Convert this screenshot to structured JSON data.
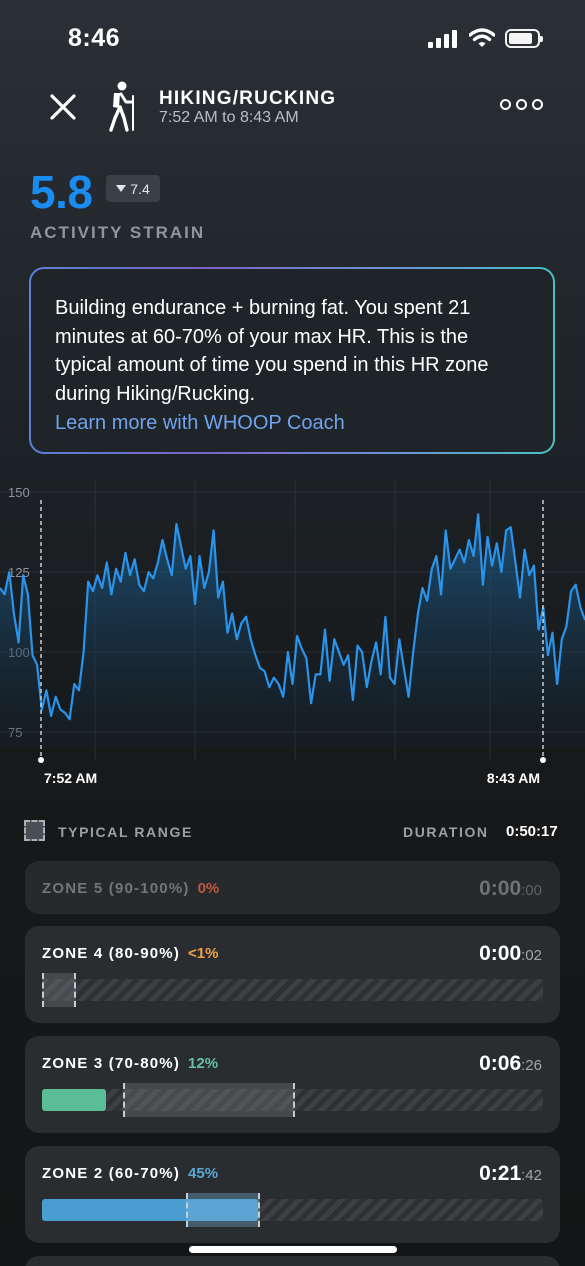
{
  "status_bar": {
    "time": "8:46"
  },
  "header": {
    "title": "HIKING/RUCKING",
    "time_range": "7:52 AM to 8:43 AM"
  },
  "strain": {
    "value": "5.8",
    "delta": "7.4",
    "label": "ACTIVITY STRAIN"
  },
  "coach": {
    "text": "Building endurance + burning fat. You spent 21 minutes at 60-70% of your max HR. This is the typical amount of time you spend in this HR zone during Hiking/Rucking.",
    "link": "Learn more with WHOOP Coach"
  },
  "chart_data": {
    "type": "line",
    "y_ticks": [
      "150",
      "125",
      "100",
      "75"
    ],
    "ylim": [
      70,
      150
    ],
    "x_labels": {
      "start": "7:52 AM",
      "end": "8:43 AM"
    },
    "series": [
      {
        "values": [
          120,
          118,
          125,
          112,
          103,
          124,
          118,
          99,
          96,
          82,
          88,
          80,
          86,
          82,
          81,
          79,
          90,
          88,
          100,
          122,
          119,
          124,
          120,
          128,
          118,
          126,
          122,
          131,
          124,
          129,
          121,
          119,
          125,
          123,
          128,
          135,
          129,
          124,
          140,
          133,
          126,
          130,
          115,
          130,
          120,
          125,
          138,
          117,
          122,
          106,
          112,
          104,
          109,
          111,
          104,
          99,
          95,
          94,
          89,
          92,
          90,
          86,
          100,
          90,
          105,
          101,
          98,
          84,
          93,
          93,
          107,
          91,
          104,
          100,
          96,
          99,
          85,
          102,
          100,
          89,
          97,
          103,
          93,
          111,
          92,
          90,
          104,
          95,
          86,
          100,
          112,
          120,
          116,
          126,
          130,
          118,
          138,
          126,
          129,
          132,
          128,
          135,
          130,
          143,
          121,
          136,
          127,
          134,
          125,
          138,
          139,
          128,
          117,
          132,
          124,
          127,
          107,
          114,
          99,
          106,
          90,
          104,
          108,
          119,
          121,
          114,
          110
        ]
      }
    ]
  },
  "zones": {
    "legend_label": "TYPICAL RANGE",
    "duration_label": "DURATION",
    "duration_value": "0:50:17",
    "items": [
      {
        "name": "ZONE 5 (90-100%)",
        "pct": "0%",
        "pct_color": "#c0563e",
        "time_main": "0:00",
        "time_sec": ":00",
        "dimmed": true
      },
      {
        "name": "ZONE 4 (80-90%)",
        "pct": "<1%",
        "pct_color": "#f0a24a",
        "time_main": "0:00",
        "time_sec": ":02"
      },
      {
        "name": "ZONE 3 (70-80%)",
        "pct": "12%",
        "pct_color": "#63c2a0",
        "time_main": "0:06",
        "time_sec": ":26",
        "fill_fraction": 0.12,
        "fill_color": "#5bbd98"
      },
      {
        "name": "ZONE 2 (60-70%)",
        "pct": "45%",
        "pct_color": "#5aa6d6",
        "time_main": "0:21",
        "time_sec": ":42",
        "fill_fraction": 0.45,
        "fill_color": "#4a9dd0"
      }
    ]
  }
}
